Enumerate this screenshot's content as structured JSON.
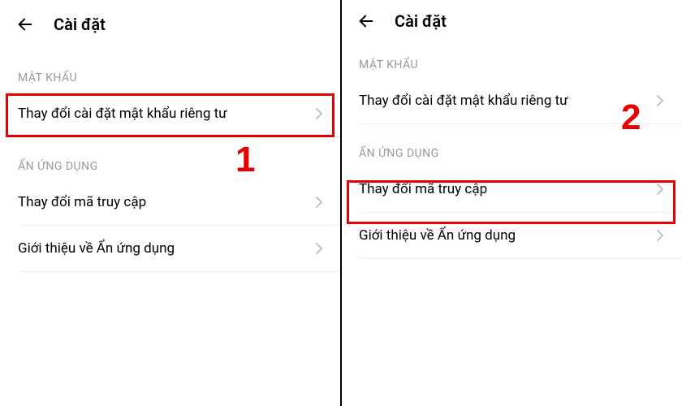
{
  "panel1": {
    "header": {
      "title": "Cài đặt"
    },
    "section1": {
      "header": "MẬT KHẨU",
      "item1_label": "Thay đổi cài đặt mật khẩu riêng tư"
    },
    "section2": {
      "header": "ẨN ỨNG DỤNG",
      "item1_label": "Thay đổi mã truy cập",
      "item2_label": "Giới thiệu về Ẩn ứng dụng"
    },
    "step_number": "1"
  },
  "panel2": {
    "header": {
      "title": "Cài đặt"
    },
    "section1": {
      "header": "MẬT KHẨU",
      "item1_label": "Thay đổi cài đặt mật khẩu riêng tư"
    },
    "section2": {
      "header": "ẨN ỨNG DỤNG",
      "item1_label": "Thay đổi mã truy cập",
      "item2_label": "Giới thiệu về Ẩn ứng dụng"
    },
    "step_number": "2"
  }
}
